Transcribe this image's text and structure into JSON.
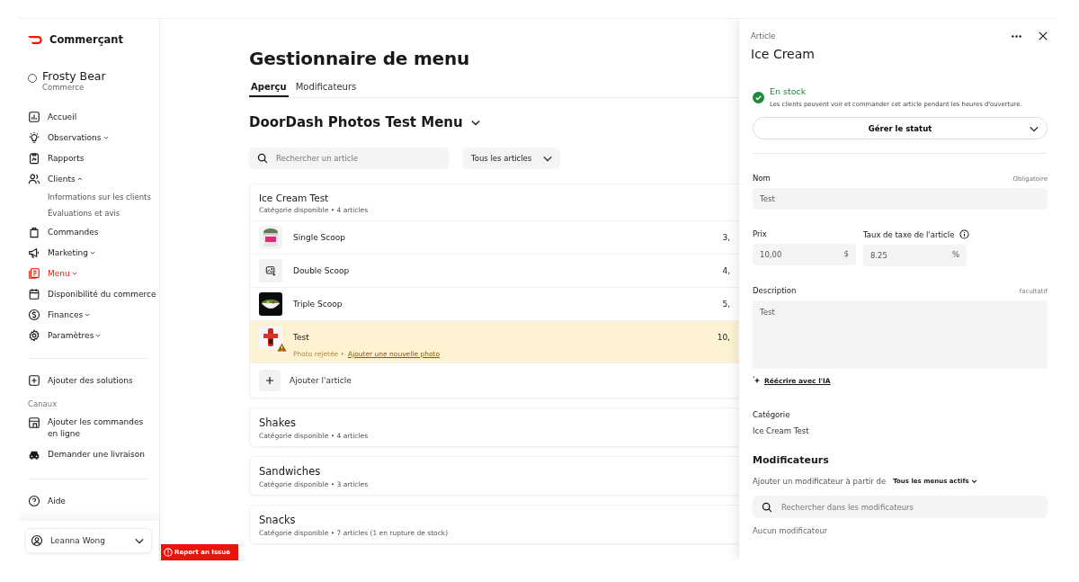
{
  "sidebar": {
    "brand": "Commerçant",
    "store": {
      "name": "Frosty Bear",
      "type": "Commerce"
    },
    "nav": [
      {
        "label": "Accueil",
        "selected": false
      },
      {
        "label": "Observations",
        "selected": false,
        "expanded": false
      },
      {
        "label": "Rapports",
        "selected": false
      },
      {
        "label": "Clients",
        "selected": false,
        "expanded": true,
        "children": [
          {
            "label": "Informations sur les clients"
          },
          {
            "label": "Évaluations et avis"
          }
        ]
      },
      {
        "label": "Commandes",
        "selected": false
      },
      {
        "label": "Marketing",
        "selected": false,
        "expanded": false
      },
      {
        "label": "Menu",
        "selected": true,
        "expanded": false
      },
      {
        "label": "Disponibilité du commerce",
        "selected": false
      },
      {
        "label": "Finances",
        "selected": false,
        "expanded": false
      },
      {
        "label": "Paramètres",
        "selected": false,
        "expanded": false
      }
    ],
    "add_solutions": "Ajouter des solutions",
    "channels_label": "Canaux",
    "channels": [
      {
        "label": "Ajouter les commandes en ligne"
      },
      {
        "label": "Demander une livraison"
      }
    ],
    "help": "Aide",
    "user": "Leanna Wong"
  },
  "report_button": "Report an Issue",
  "main": {
    "title": "Gestionnaire de menu",
    "tabs": [
      {
        "label": "Aperçu",
        "selected": true
      },
      {
        "label": "Modificateurs",
        "selected": false
      }
    ],
    "menu_name": "DoorDash Photos Test Menu",
    "search": {
      "placeholder": "Rechercher un article"
    },
    "filter": "Tous les articles",
    "categories": [
      {
        "name": "Ice Cream Test",
        "info": "Catégorie disponible • 4 articles",
        "expanded": true,
        "items": [
          {
            "name": "Single Scoop",
            "price": "3,",
            "selected": false,
            "warning": false
          },
          {
            "name": "Double Scoop",
            "price": "4,",
            "kind": "placeholder",
            "selected": false,
            "warning": false
          },
          {
            "name": "Triple Scoop",
            "price": "5,",
            "selected": false,
            "warning": false
          },
          {
            "name": "Test",
            "price": "10,",
            "selected": true,
            "warning": true,
            "status": "Photo rejetée •",
            "link": "Ajouter une nouvelle photo"
          }
        ],
        "add_label": "Ajouter l'article"
      },
      {
        "name": "Shakes",
        "info": "Catégorie disponible • 4 articles",
        "expanded": false
      },
      {
        "name": "Sandwiches",
        "info": "Catégorie disponible • 3 articles",
        "expanded": false
      },
      {
        "name": "Snacks",
        "info": "Catégorie disponible • 7 articles (1 en rupture de stock)",
        "expanded": false
      }
    ]
  },
  "panel": {
    "label": "Article",
    "title": "Ice Cream",
    "status": {
      "in_stock": true,
      "title": "En stock",
      "description": "Les clients peuvent voir et commander cet article pendant les heures d'ouverture.",
      "button": "Gérer le statut"
    },
    "name_field": {
      "label": "Nom",
      "hint": "Obligatoire",
      "value": "Test"
    },
    "price_field": {
      "label": "Prix",
      "value": "10,00",
      "unit": "$"
    },
    "tax_field": {
      "label": "Taux de taxe de l'article",
      "value": "8.25",
      "unit": "%"
    },
    "description_field": {
      "label": "Description",
      "hint": "facultatif",
      "value": "Test"
    },
    "rewrite_link": "Réécrire avec l'IA",
    "category": {
      "label": "Catégorie",
      "value": "Ice Cream Test"
    },
    "modifiers": {
      "title": "Modificateurs",
      "add_text": "Ajouter un modificateur à partir de",
      "source": "Tous les menus actifs",
      "search": {
        "placeholder": "Rechercher dans les modificateurs"
      },
      "empty": "Aucun modificateur"
    }
  }
}
